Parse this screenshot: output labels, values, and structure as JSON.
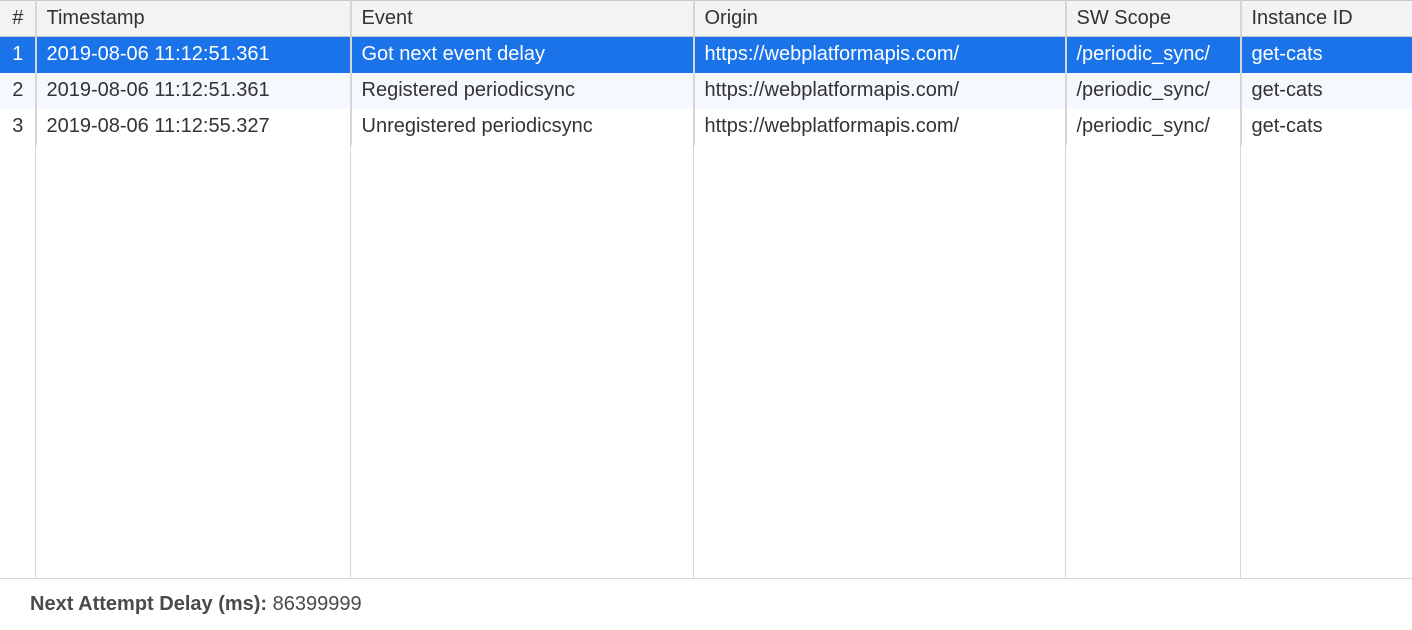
{
  "columns": {
    "index": "#",
    "timestamp": "Timestamp",
    "event": "Event",
    "origin": "Origin",
    "sw_scope": "SW Scope",
    "instance_id": "Instance ID"
  },
  "rows": [
    {
      "index": "1",
      "timestamp": "2019-08-06 11:12:51.361",
      "event": "Got next event delay",
      "origin": "https://webplatformapis.com/",
      "sw_scope": "/periodic_sync/",
      "instance_id": "get-cats",
      "selected": true
    },
    {
      "index": "2",
      "timestamp": "2019-08-06 11:12:51.361",
      "event": "Registered periodicsync",
      "origin": "https://webplatformapis.com/",
      "sw_scope": "/periodic_sync/",
      "instance_id": "get-cats",
      "selected": false
    },
    {
      "index": "3",
      "timestamp": "2019-08-06 11:12:55.327",
      "event": "Unregistered periodicsync",
      "origin": "https://webplatformapis.com/",
      "sw_scope": "/periodic_sync/",
      "instance_id": "get-cats",
      "selected": false
    }
  ],
  "footer": {
    "label": "Next Attempt Delay (ms): ",
    "value": "86399999"
  }
}
